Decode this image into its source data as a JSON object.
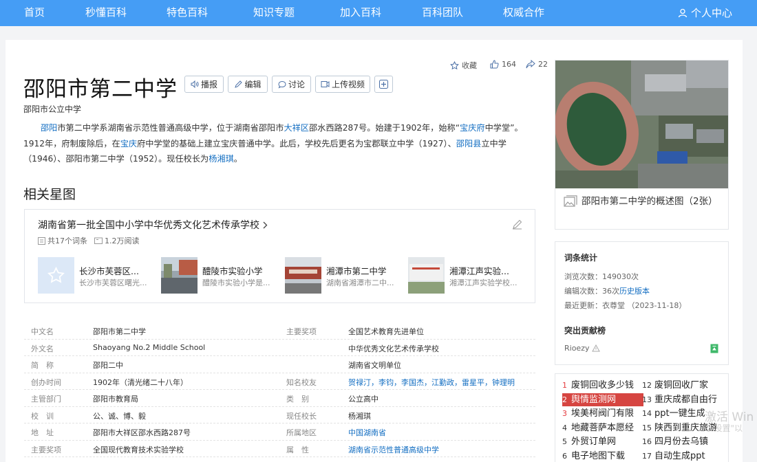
{
  "nav": {
    "items": [
      "首页",
      "秒懂百科",
      "特色百科",
      "知识专题",
      "加入百科",
      "百科团队",
      "权威合作"
    ],
    "user": "个人中心"
  },
  "entry": {
    "title": "邵阳市第二中学",
    "subtitle": "邵阳市公立中学",
    "buttons": {
      "play": "播报",
      "edit": "编辑",
      "discuss": "讨论",
      "upload_video": "上传视频"
    },
    "collect": "收藏",
    "likes": "164",
    "shares": "22"
  },
  "summary": {
    "parts": [
      {
        "t": "邵阳",
        "link": true
      },
      {
        "t": "市第二中学系湖南省示范性普通高级中学，位于湖南省邵阳市",
        "link": false
      },
      {
        "t": "大祥区",
        "link": true
      },
      {
        "t": "邵水西路287号。始建于1902年，始称“",
        "link": false
      },
      {
        "t": "宝庆府",
        "link": true
      },
      {
        "t": "中学堂”。1912年，府制废除后，在",
        "link": false
      },
      {
        "t": "宝庆",
        "link": true
      },
      {
        "t": "府中学堂的基础上建立宝庆普通中学。此后，学校先后更名为宝郡联立中学（1927）、",
        "link": false
      },
      {
        "t": "邵阳县",
        "link": true
      },
      {
        "t": "立中学（1946）、邵阳市第二中学（1952）。现任校长为",
        "link": false
      },
      {
        "t": "杨湘琪",
        "link": true
      },
      {
        "t": "。",
        "link": false
      }
    ]
  },
  "star": {
    "heading": "相关星图",
    "title": "湖南省第一批全国中小学中华优秀文化艺术传承学校",
    "count": "共17个词条",
    "reads": "1.2万阅读",
    "items": [
      {
        "title": "长沙市芙蓉区...",
        "sub": "长沙市芙蓉区曙光..."
      },
      {
        "title": "醴陵市实验小学",
        "sub": "醴陵市实验小学是..."
      },
      {
        "title": "湘潭市第二中学",
        "sub": "湖南省湘潭市二中..."
      },
      {
        "title": "湘潭江声实验...",
        "sub": "湘潭江声实验学校..."
      }
    ]
  },
  "info": {
    "left": [
      {
        "label": "中文名",
        "value": "邵阳市第二中学"
      },
      {
        "label": "外文名",
        "value": "Shaoyang No.2 Middle School"
      },
      {
        "label": "简　称",
        "value": "邵阳二中"
      },
      {
        "label": "创办时间",
        "value": "1902年（清光绪二十八年）"
      },
      {
        "label": "主管部门",
        "value": "邵阳市教育局"
      },
      {
        "label": "校　训",
        "value": "公、诚、博、毅"
      },
      {
        "label": "地　址",
        "value": "邵阳市大祥区邵水西路287号"
      },
      {
        "label": "主要奖项",
        "value": "全国现代教育技术实验学校"
      }
    ],
    "right": [
      {
        "label": "主要奖项",
        "value": "全国艺术教育先进单位"
      },
      {
        "label": "",
        "value": "中华优秀文化艺术传承学校"
      },
      {
        "label": "",
        "value": "湖南省文明单位"
      },
      {
        "label": "知名校友",
        "value": "贺禄汀，李钧，李国杰，江勤政，雷星平，钟理明"
      },
      {
        "label": "类　别",
        "value": "公立高中"
      },
      {
        "label": "现任校长",
        "value": "杨湘琪"
      },
      {
        "label": "所属地区",
        "value": "中国湖南省"
      },
      {
        "label": "属　性",
        "value": "湖南省示范性普通高级中学"
      }
    ]
  },
  "sidebar": {
    "album_caption": "邵阳市第二中学的概述图（2张）",
    "stats_title": "词条统计",
    "views": "浏览次数：149030次",
    "edits_prefix": "编辑次数：36次",
    "history": "历史版本",
    "updated": "最近更新：衣尊堂 （2023-11-18）",
    "contrib_title": "突出贡献榜",
    "contributor": "Rioezy"
  },
  "hot": [
    {
      "n": "1",
      "t": "废铜回收多少钱"
    },
    {
      "n": "12",
      "t": "废铜回收厂家"
    },
    {
      "n": "2",
      "t": "舆情监测网"
    },
    {
      "n": "13",
      "t": "重庆成都自由行"
    },
    {
      "n": "3",
      "t": "埃美柯阀门有限"
    },
    {
      "n": "14",
      "t": "ppt一键生成"
    },
    {
      "n": "4",
      "t": "地藏菩萨本愿经"
    },
    {
      "n": "15",
      "t": "陕西到重庆旅游"
    },
    {
      "n": "5",
      "t": "外贸订单网"
    },
    {
      "n": "16",
      "t": "四月份去乌镇"
    },
    {
      "n": "6",
      "t": "电子地图下载"
    },
    {
      "n": "17",
      "t": "自动生成ppt"
    }
  ],
  "watermark": {
    "line1": "激活 Win",
    "line2": "到\"设置\"以"
  },
  "colors": {
    "nav": "#459df5",
    "link": "#136ec2",
    "hot_sel": "#d64541"
  }
}
